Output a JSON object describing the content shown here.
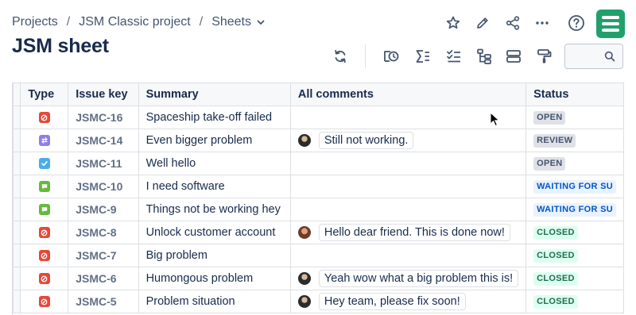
{
  "breadcrumb": {
    "items": [
      "Projects",
      "JSM Classic project",
      "Sheets"
    ],
    "separator": "/"
  },
  "page": {
    "title": "JSM sheet"
  },
  "header_actions": [
    "star-icon",
    "edit-icon",
    "share-icon",
    "more-icon",
    "help-icon",
    "app-logo"
  ],
  "toolbar_icons": [
    "refresh-icon",
    "history-icon",
    "sum-icon",
    "checklist-icon",
    "hierarchy-icon",
    "rows-icon",
    "format-paint-icon",
    "search-icon"
  ],
  "search": {
    "value": "",
    "placeholder": ""
  },
  "table": {
    "columns": [
      "Type",
      "Issue key",
      "Summary",
      "All comments",
      "Status"
    ],
    "rows": [
      {
        "type": "incident",
        "key": "JSMC-16",
        "summary": "Spaceship take-off failed",
        "comment": "",
        "avatar": "",
        "status": "OPEN",
        "status_style": "grey"
      },
      {
        "type": "change",
        "key": "JSMC-14",
        "summary": "Even bigger problem",
        "comment": "Still not working.",
        "avatar": "a1",
        "status": "REVIEW",
        "status_style": "grey"
      },
      {
        "type": "task",
        "key": "JSMC-11",
        "summary": "Well hello",
        "comment": "",
        "avatar": "",
        "status": "OPEN",
        "status_style": "grey"
      },
      {
        "type": "service-request",
        "key": "JSMC-10",
        "summary": "I need software",
        "comment": "",
        "avatar": "",
        "status": "WAITING FOR SU",
        "status_style": "blue"
      },
      {
        "type": "service-request",
        "key": "JSMC-9",
        "summary": "Things not be working hey",
        "comment": "",
        "avatar": "",
        "status": "WAITING FOR SU",
        "status_style": "blue"
      },
      {
        "type": "incident",
        "key": "JSMC-8",
        "summary": "Unlock customer account",
        "comment": "Hello dear friend. This is done now!",
        "avatar": "a2",
        "status": "CLOSED",
        "status_style": "green"
      },
      {
        "type": "incident",
        "key": "JSMC-7",
        "summary": "Big problem",
        "comment": "",
        "avatar": "",
        "status": "CLOSED",
        "status_style": "green"
      },
      {
        "type": "incident",
        "key": "JSMC-6",
        "summary": "Humongous problem",
        "comment": "Yeah wow what a big problem this is!",
        "avatar": "a1",
        "status": "CLOSED",
        "status_style": "green"
      },
      {
        "type": "incident",
        "key": "JSMC-5",
        "summary": "Problem situation",
        "comment": "Hey team, please fix soon!",
        "avatar": "a1",
        "status": "CLOSED",
        "status_style": "green"
      }
    ]
  },
  "colors": {
    "incident": "#e5493a",
    "change": "#8f7ee7",
    "task": "#4bade8",
    "service-request": "#63ba3c",
    "brand": "#22a06b"
  }
}
